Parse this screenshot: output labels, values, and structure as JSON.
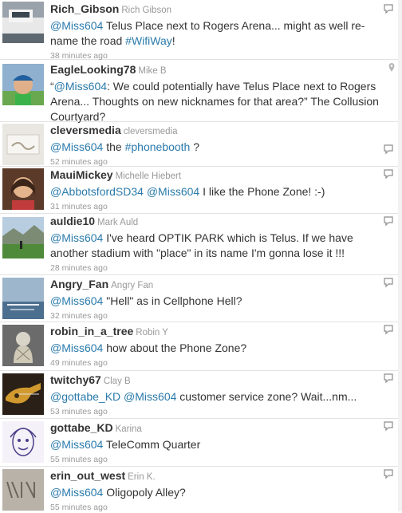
{
  "tweets": [
    {
      "handle": "Rich_Gibson",
      "name": "Rich Gibson",
      "text_parts": [
        "@Miss604",
        " Telus Place next to Rogers Arena... might as well re-name the road ",
        "#WifiWay",
        "!"
      ],
      "time": "38 minutes ago"
    },
    {
      "handle": "EagleLooking78",
      "name": "Mike B",
      "text_parts": [
        "“",
        "@Miss604",
        ": We could potentially have Telus Place next to Rogers Arena... Thoughts on new nicknames for that area?” The Collusion Courtyard?"
      ],
      "time": ""
    },
    {
      "handle": "cleversmedia",
      "name": "cleversmedia",
      "text_parts": [
        "@Miss604",
        " the ",
        "#phonebooth",
        " ?"
      ],
      "time": "52 minutes ago"
    },
    {
      "handle": "MauiMickey",
      "name": "Michelle Hiebert",
      "text_parts": [
        "@AbbotsfordSD34",
        " ",
        "@Miss604",
        " I like the Phone Zone! :-)"
      ],
      "time": "31 minutes ago"
    },
    {
      "handle": "auldie10",
      "name": "Mark Auld",
      "text_parts": [
        "@Miss604",
        " I've heard OPTIK PARK which is Telus. If we have another stadium with \"place\" in its name I'm gonna lose it !!!"
      ],
      "time": "28 minutes ago"
    },
    {
      "handle": "Angry_Fan",
      "name": "Angry Fan",
      "text_parts": [
        "@Miss604",
        " \"Hell\" as in Cellphone Hell?"
      ],
      "time": "32 minutes ago"
    },
    {
      "handle": "robin_in_a_tree",
      "name": "Robin Y",
      "text_parts": [
        "@Miss604",
        " how about the Phone Zone?"
      ],
      "time": "49 minutes ago"
    },
    {
      "handle": "twitchy67",
      "name": "Clay B",
      "text_parts": [
        "@gottabe_KD",
        " ",
        "@Miss604",
        " customer service zone? Wait...nm..."
      ],
      "time": "53 minutes ago"
    },
    {
      "handle": "gottabe_KD",
      "name": "Karina",
      "text_parts": [
        "@Miss604",
        " TeleComm Quarter"
      ],
      "time": "55 minutes ago"
    },
    {
      "handle": "erin_out_west",
      "name": "Erin K.",
      "text_parts": [
        "@Miss604",
        " Oligopoly Alley?"
      ],
      "time": "55 minutes ago"
    }
  ],
  "icons": {
    "reply": "reply-icon",
    "location": "location-pin-icon"
  },
  "colors": {
    "link": "#2a7aab",
    "text": "#333333",
    "meta": "#999999",
    "divider": "#e2e2e2"
  }
}
